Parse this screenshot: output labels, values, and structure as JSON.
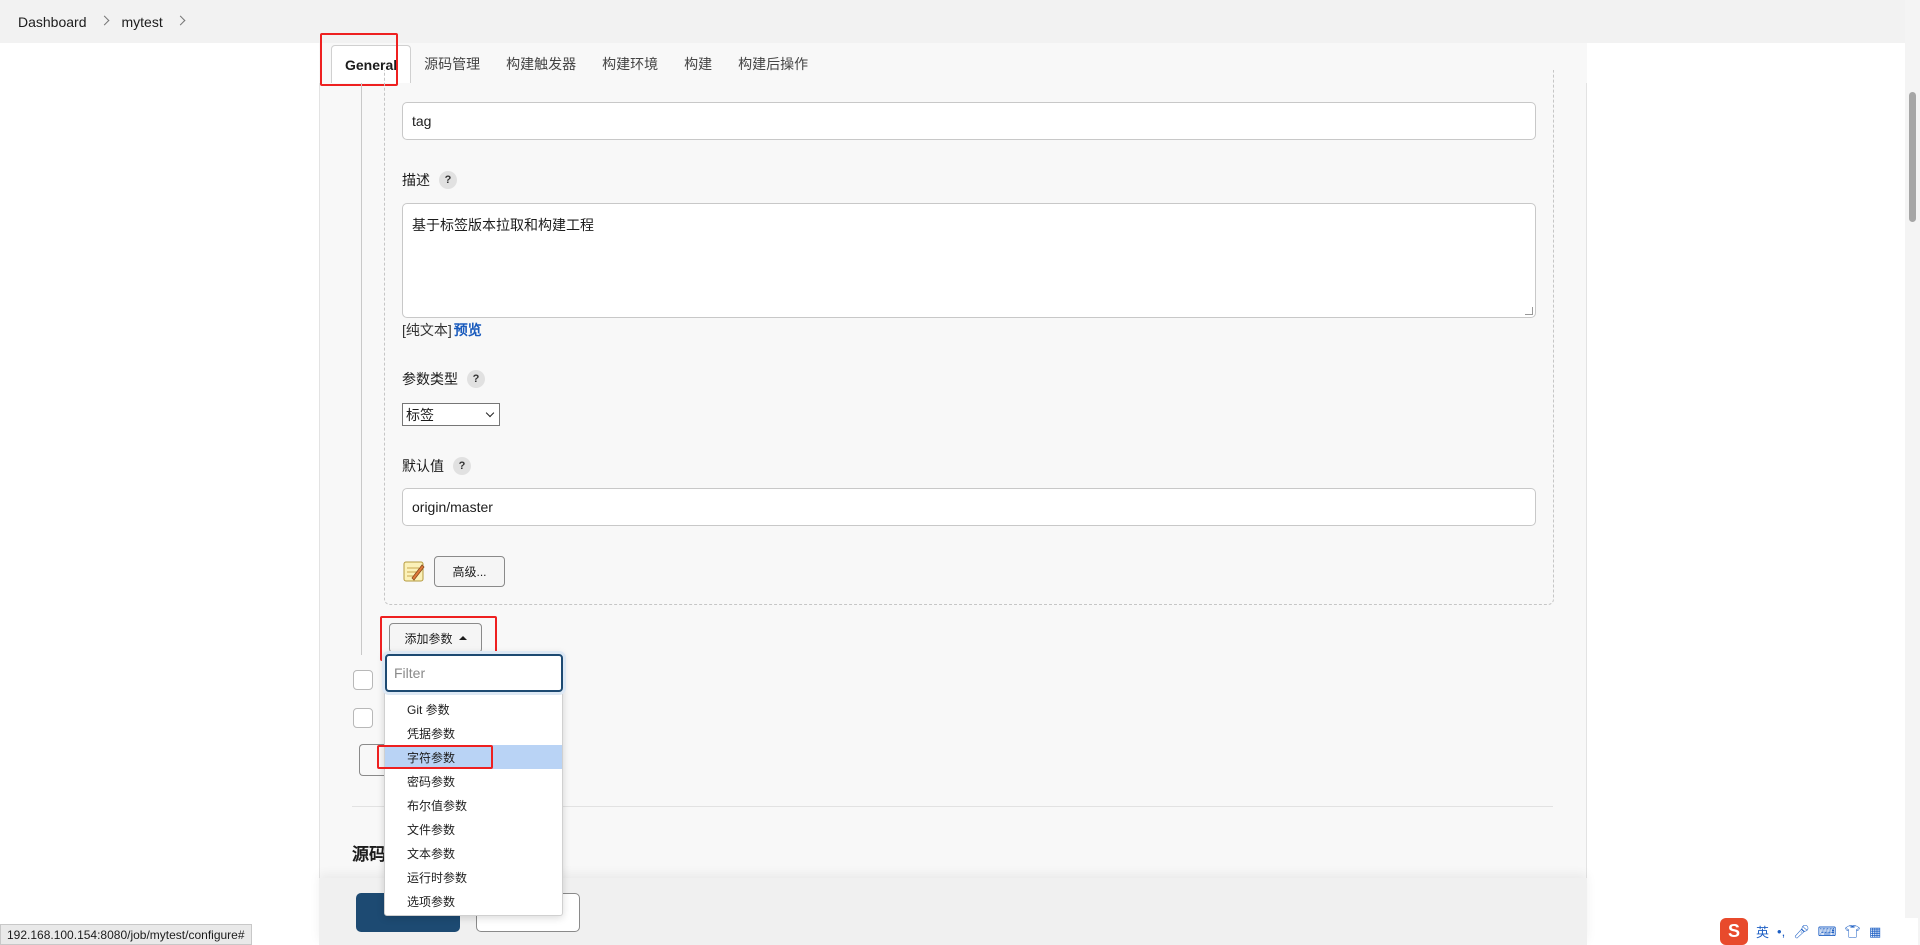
{
  "breadcrumb": {
    "items": [
      "Dashboard",
      "mytest"
    ]
  },
  "tabs": [
    {
      "label": "General",
      "active": true
    },
    {
      "label": "源码管理"
    },
    {
      "label": "构建触发器"
    },
    {
      "label": "构建环境"
    },
    {
      "label": "构建"
    },
    {
      "label": "构建后操作"
    }
  ],
  "param_form": {
    "name_value": "tag",
    "description_label": "描述",
    "description_value": "基于标签版本拉取和构建工程",
    "plain_text_link": "[纯文本]",
    "preview_link": "预览",
    "param_type_label": "参数类型",
    "param_type_value": "标签",
    "default_label": "默认值",
    "default_value": "origin/master",
    "advanced_button": "高级...",
    "help_glyph": "?"
  },
  "add_param_button": "添加参数",
  "dropdown": {
    "filter_placeholder": "Filter",
    "items": [
      "Git 参数",
      "凭据参数",
      "字符参数",
      "密码参数",
      "布尔值参数",
      "文件参数",
      "文本参数",
      "运行时参数",
      "选项参数"
    ],
    "highlighted_index": 2
  },
  "section": {
    "title": "源码"
  },
  "status_url": "192.168.100.154:8080/job/mytest/configure#",
  "ime": {
    "logo": "S",
    "mode": "英"
  },
  "colors": {
    "accent": "#1d4a72",
    "highlight": "#b9d3f5",
    "annotation": "#ee2020",
    "link": "#1a5bbd"
  }
}
